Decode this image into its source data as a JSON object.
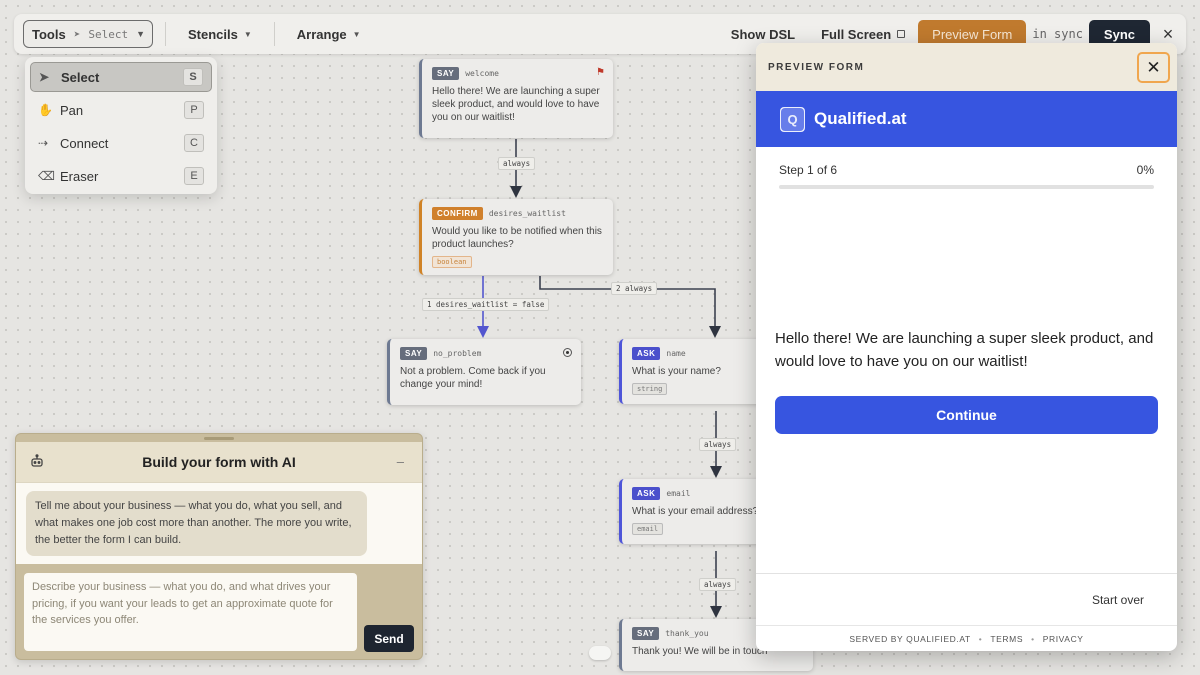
{
  "toolbar": {
    "tools_label": "Tools",
    "tools_current": "Select",
    "stencils_label": "Stencils",
    "arrange_label": "Arrange",
    "show_dsl_label": "Show DSL",
    "full_screen_label": "Full Screen",
    "preview_form_label": "Preview Form",
    "sync_status": "in sync",
    "sync_label": "Sync",
    "close_icon": "×"
  },
  "tools_menu": {
    "items": [
      {
        "label": "Select",
        "key": "S",
        "icon": "➤"
      },
      {
        "label": "Pan",
        "key": "P",
        "icon": "✋"
      },
      {
        "label": "Connect",
        "key": "C",
        "icon": "⇢"
      },
      {
        "label": "Eraser",
        "key": "E",
        "icon": "⌫"
      }
    ]
  },
  "nodes": {
    "welcome": {
      "type": "SAY",
      "id": "welcome",
      "text": "Hello there! We are launching a super sleek product, and would love to have you on our waitlist!"
    },
    "desires_waitlist": {
      "type": "CONFIRM",
      "id": "desires_waitlist",
      "text": "Would you like to be notified when this product launches?",
      "data_type": "boolean"
    },
    "no_problem": {
      "type": "SAY",
      "id": "no_problem",
      "text": "Not a problem. Come back if you change your mind!"
    },
    "name": {
      "type": "ASK",
      "id": "name",
      "text": "What is your name?",
      "data_type": "string"
    },
    "email": {
      "type": "ASK",
      "id": "email",
      "text": "What is your email address?",
      "data_type": "email"
    },
    "thank_you": {
      "type": "SAY",
      "id": "thank_you",
      "text": "Thank you! We will be in touch"
    }
  },
  "edges": {
    "e1": "always",
    "e2": "1 desires_waitlist = false",
    "e3": "2 always",
    "e4": "always",
    "e5": "always"
  },
  "ai_panel": {
    "title": "Build your form with AI",
    "bot_icon": "robot-icon",
    "minimize": "–",
    "assistant_message": "Tell me about your business — what you do, what you sell, and what makes one job cost more than another. The more you write, the better the form I can build.",
    "input_placeholder": "Describe your business — what you do, and what drives your pricing, if you want your leads to get an approximate quote for the services you offer.",
    "send_label": "Send"
  },
  "preview": {
    "title": "PREVIEW FORM",
    "close": "✕",
    "brand_initial": "Q",
    "brand_name": "Qualified.at",
    "step_text": "Step 1 of 6",
    "progress_text": "0%",
    "progress": 0,
    "message": "Hello there! We are launching a super sleek product, and would love to have you on our waitlist!",
    "continue_label": "Continue",
    "start_over_label": "Start over",
    "footer": {
      "served_by": "SERVED BY  QUALIFIED.AT",
      "terms": "TERMS",
      "privacy": "PRIVACY",
      "separator": "•"
    }
  },
  "colors": {
    "brand_blue": "#3755e0",
    "preview_orange": "#c07a2e",
    "confirm_orange": "#d0802c",
    "ask_indigo": "#4b50cc"
  }
}
